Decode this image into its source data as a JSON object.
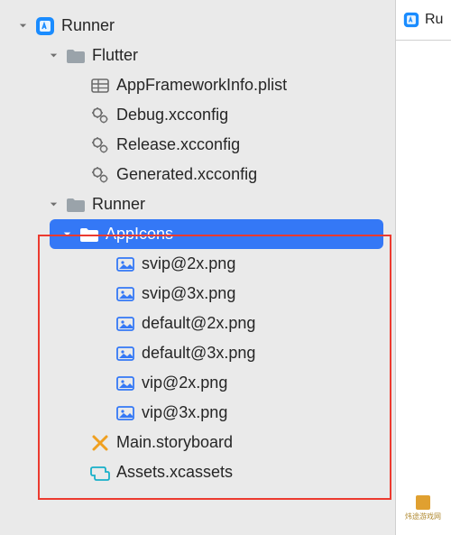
{
  "rightpanel": {
    "label": "Ru"
  },
  "tree": {
    "runner_root": {
      "label": "Runner"
    },
    "flutter_group": {
      "label": "Flutter"
    },
    "appframework": {
      "label": "AppFrameworkInfo.plist"
    },
    "debug_xcconfig": {
      "label": "Debug.xcconfig"
    },
    "release_xcconfig": {
      "label": "Release.xcconfig"
    },
    "generated_xcconfig": {
      "label": "Generated.xcconfig"
    },
    "runner_group": {
      "label": "Runner"
    },
    "appicons_group": {
      "label": "AppIcons"
    },
    "svip2x": {
      "label": "svip@2x.png"
    },
    "svip3x": {
      "label": "svip@3x.png"
    },
    "default2x": {
      "label": "default@2x.png"
    },
    "default3x": {
      "label": "default@3x.png"
    },
    "vip2x": {
      "label": "vip@2x.png"
    },
    "vip3x": {
      "label": "vip@3x.png"
    },
    "main_storyboard": {
      "label": "Main.storyboard"
    },
    "assets_xcassets": {
      "label": "Assets.xcassets"
    }
  },
  "watermark": {
    "text": "炜途游戏网"
  }
}
